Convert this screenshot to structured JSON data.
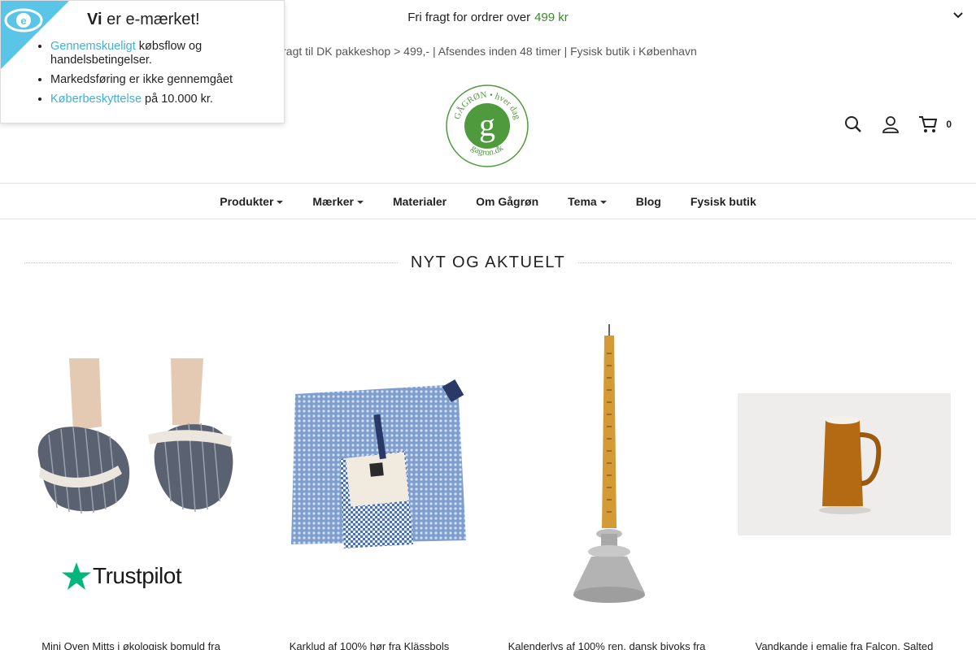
{
  "topbar": {
    "text": "Fri fragt for ordrer over",
    "price": "499 kr"
  },
  "infoline": {
    "text": "fragt til DK pakkeshop > 499,- | Afsendes inden 48 timer | Fysisk butik i København"
  },
  "header": {
    "logo_text_top": "GÅGRØN • hver dag",
    "logo_letter": "g",
    "logo_text_bottom": "gagron.dk",
    "cart_count": "0"
  },
  "nav": {
    "items": [
      {
        "label": "Produkter",
        "dropdown": true
      },
      {
        "label": "Mærker",
        "dropdown": true
      },
      {
        "label": "Materialer",
        "dropdown": false
      },
      {
        "label": "Om Gågrøn",
        "dropdown": false
      },
      {
        "label": "Tema",
        "dropdown": true
      },
      {
        "label": "Blog",
        "dropdown": false
      },
      {
        "label": "Fysisk butik",
        "dropdown": false
      }
    ]
  },
  "section": {
    "title": "NYT OG AKTUELT"
  },
  "products": [
    {
      "title": "Mini Oven Mitts i økologisk bomuld fra"
    },
    {
      "title": "Karklud af 100% hør fra Klässbols"
    },
    {
      "title": "Kalenderlys af 100% ren, dansk bivoks fra"
    },
    {
      "title": "Vandkande i emalje fra Falcon, Salted"
    }
  ],
  "emark": {
    "heading_bold": "Vi",
    "heading_rest": " er e-mærket!",
    "items": [
      {
        "link": "Gennemskueligt",
        "text": " købsflow og handelsbetingelser."
      },
      {
        "link": "",
        "text": "Markedsføring er ikke gennemgået"
      },
      {
        "link": "Køberbeskyttelse",
        "text": " på 10.000 kr."
      }
    ]
  },
  "trustpilot": {
    "label": "Trustpilot"
  },
  "colors": {
    "accent_green": "#3a8a2a",
    "logo_green": "#4f9a3c",
    "link_blue": "#3db1d9",
    "emark_blue": "#5bc4e9"
  }
}
